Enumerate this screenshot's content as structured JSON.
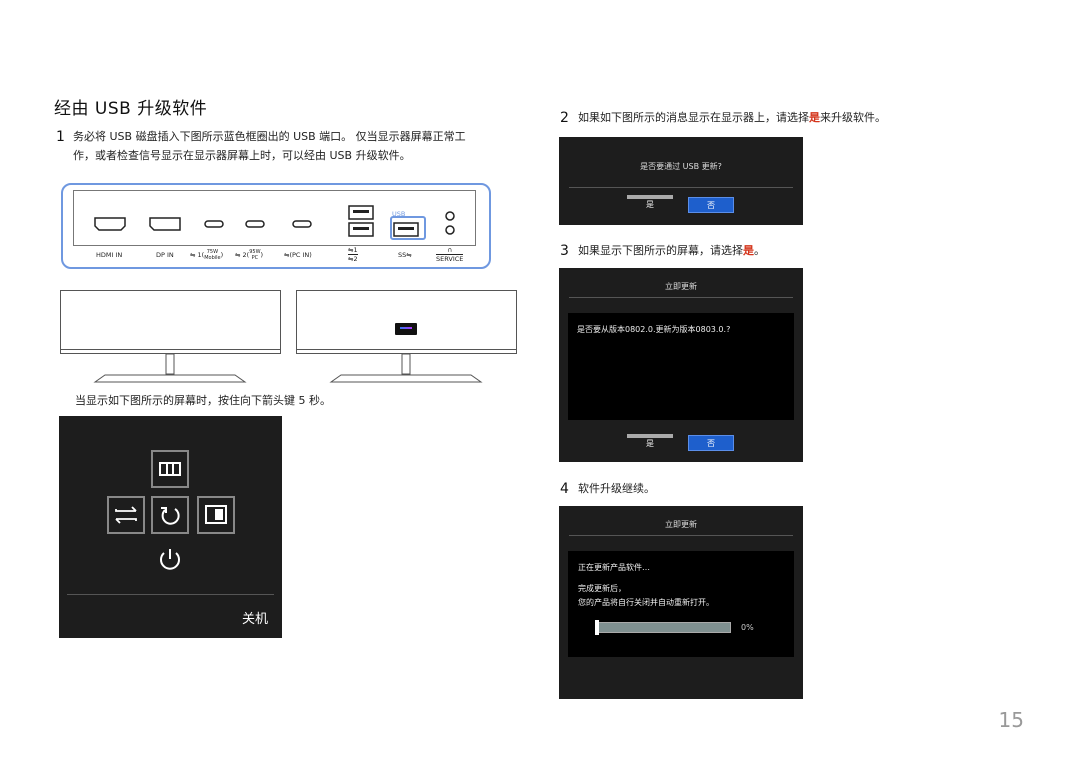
{
  "section_title": "经由 USB 升级软件",
  "steps": {
    "s1": {
      "num": "1",
      "text_line1": "务必将 USB 磁盘插入下图所示蓝色框圈出的 USB 端口。 仅当显示器屏幕正常工",
      "text_line2": "作，或者检查信号显示在显示器屏幕上时，可以经由 USB 升级软件。"
    },
    "s2": {
      "num": "2",
      "text_before": "如果如下图所示的消息显示在显示器上，请选择",
      "highlight": "是",
      "text_after": "来升级软件。"
    },
    "s3": {
      "num": "3",
      "text_before": "如果显示下图所示的屏幕，请选择",
      "highlight": "是",
      "text_after": "。"
    },
    "s4": {
      "num": "4",
      "text": "软件升级继续。"
    }
  },
  "ports": {
    "hdmi": "HDMI IN",
    "dp": "DP IN",
    "c1_top": "75W",
    "c1_prefix": "1(",
    "c1_bottom": "Mobile",
    "c2_top": "95W",
    "c2_prefix": "2(",
    "c2_bottom": "PC",
    "pc_in": "(PC IN)",
    "usb1": "1",
    "usb2": "2",
    "usb_label": "USB",
    "service": "SERVICE"
  },
  "instruction": "当显示如下图所示的屏幕时，按住向下箭头键 5 秒。",
  "osd": {
    "power_off_label": "关机"
  },
  "dialog1": {
    "question": "是否要通过 USB 更新?",
    "yes": "是",
    "no": "否"
  },
  "dialog2": {
    "title": "立即更新",
    "question": "是否要从版本0802.0.更新为版本0803.0.?",
    "yes": "是",
    "no": "否"
  },
  "dialog3": {
    "title": "立即更新",
    "line1": "正在更新产品软件…",
    "line2": "完成更新后，",
    "line3": "您的产品将自行关闭并自动重新打开。",
    "progress_label": "0%",
    "progress": 0
  },
  "page_number": "15",
  "colors": {
    "highlight": "#d4351c",
    "panel_border": "#6f98e0",
    "button_blue": "#1e5fcc",
    "dark_bg": "#1d1d1d"
  }
}
